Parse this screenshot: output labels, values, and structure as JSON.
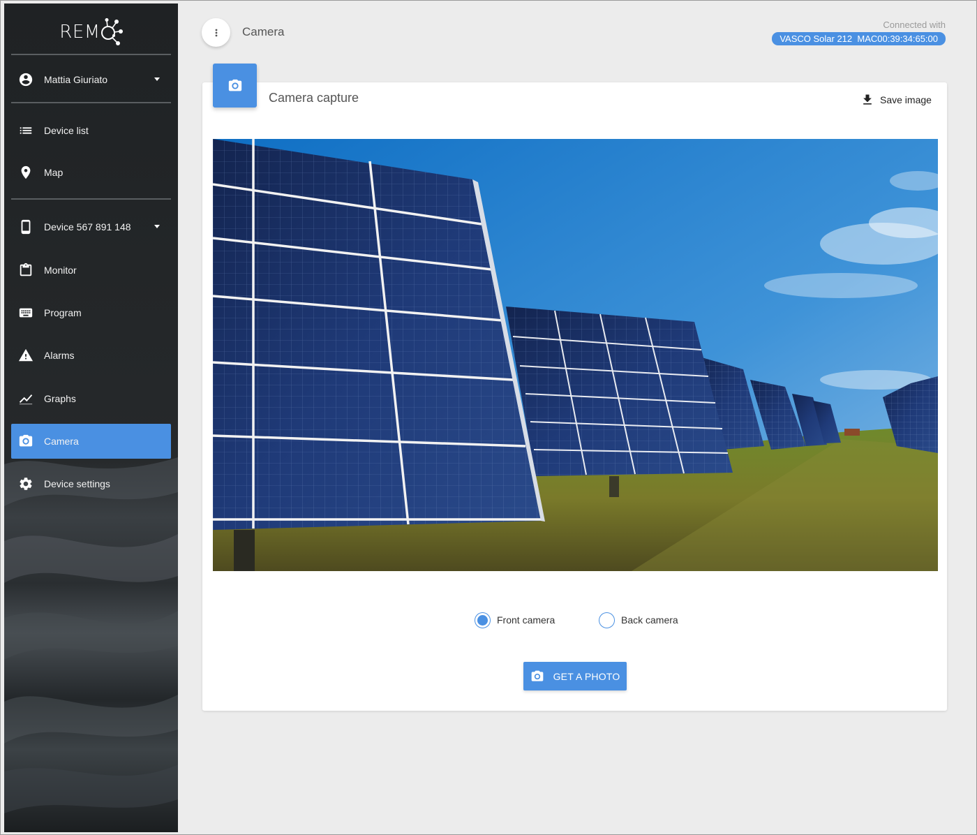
{
  "app": {
    "logo_text": "REM",
    "brand_color": "#4a90e2"
  },
  "sidebar": {
    "user": {
      "name": "Mattia Giuriato",
      "icon": "account-circle-icon"
    },
    "items": [
      {
        "label": "Device list",
        "icon": "list-icon"
      },
      {
        "label": "Map",
        "icon": "map-pin-icon"
      }
    ],
    "device": {
      "label": "Device 567 891 148",
      "icon": "smartphone-icon"
    },
    "device_items": [
      {
        "label": "Monitor",
        "icon": "clipboard-icon"
      },
      {
        "label": "Program",
        "icon": "keyboard-icon"
      },
      {
        "label": "Alarms",
        "icon": "warning-icon"
      },
      {
        "label": "Graphs",
        "icon": "chart-line-icon"
      },
      {
        "label": "Camera",
        "icon": "camera-icon",
        "active": true
      },
      {
        "label": "Device settings",
        "icon": "gear-icon"
      }
    ]
  },
  "header": {
    "title": "Camera",
    "connected_label": "Connected with",
    "connected_device": "VASCO Solar 212  MAC00:39:34:65:00"
  },
  "card": {
    "title": "Camera capture",
    "save_label": "Save image",
    "photo_subject": "solar-panels-photo",
    "camera_options": [
      {
        "label": "Front camera",
        "selected": true
      },
      {
        "label": "Back camera",
        "selected": false
      }
    ],
    "get_photo_label": "GET A PHOTO"
  }
}
